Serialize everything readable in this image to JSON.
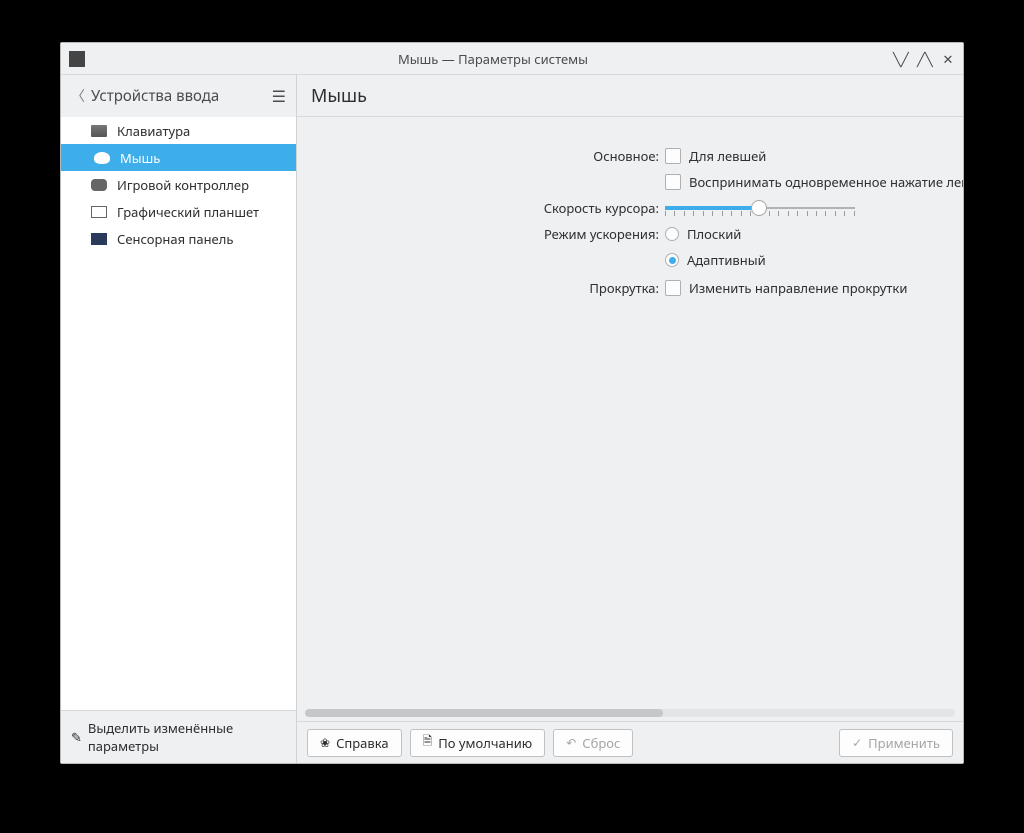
{
  "window": {
    "title": "Мышь — Параметры системы"
  },
  "sidebar": {
    "header": "Устройства ввода",
    "items": [
      {
        "label": "Клавиатура"
      },
      {
        "label": "Мышь"
      },
      {
        "label": "Игровой контроллер"
      },
      {
        "label": "Графический планшет"
      },
      {
        "label": "Сенсорная панель"
      }
    ],
    "highlight": "Выделить изменённые параметры"
  },
  "main": {
    "title": "Мышь",
    "primary_label": "Основное:",
    "left_handed": "Для левшей",
    "simultaneous": "Воспринимать одновременное нажатие левой",
    "cursor_speed": "Скорость курсора:",
    "accel_mode": "Режим ускорения:",
    "accel_flat": "Плоский",
    "accel_adaptive": "Адаптивный",
    "scroll_label": "Прокрутка:",
    "scroll_invert": "Изменить направление прокрутки"
  },
  "footer": {
    "help": "Справка",
    "defaults": "По умолчанию",
    "reset": "Сброс",
    "apply": "Применить"
  }
}
